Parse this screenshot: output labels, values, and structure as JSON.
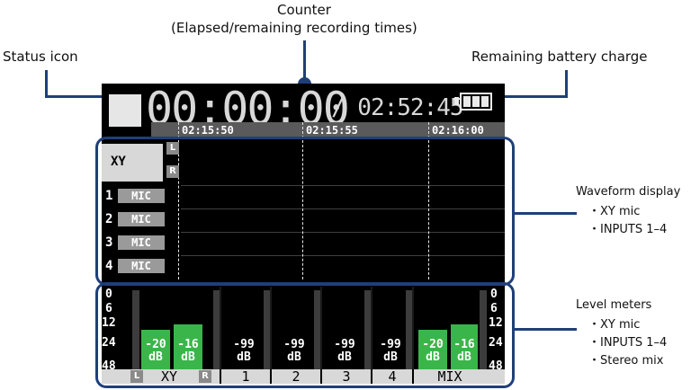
{
  "annotations": {
    "counter_line1": "Counter",
    "counter_line2": "(Elapsed/remaining recording times)",
    "status_icon": "Status icon",
    "battery": "Remaining battery charge",
    "waveform_title": "Waveform display",
    "waveform_items": [
      "・XY mic",
      "・INPUTS 1–4"
    ],
    "level_title": "Level meters",
    "level_items": [
      "・XY mic",
      "・INPUTS 1–4",
      "・Stereo mix"
    ]
  },
  "screen": {
    "elapsed": "00:00:00",
    "slash_remaining": "/ 02:52:45",
    "battery_icon": "battery-full-icon",
    "timeline": [
      "02:15:50",
      "02:15:55",
      "02:16:00"
    ],
    "waveform": {
      "xy_label": "XY",
      "left_tag": "L",
      "right_tag": "R",
      "inputs": [
        {
          "num": "1",
          "tag": "MIC"
        },
        {
          "num": "2",
          "tag": "MIC"
        },
        {
          "num": "3",
          "tag": "MIC"
        },
        {
          "num": "4",
          "tag": "MIC"
        }
      ]
    },
    "meters": {
      "scale": [
        "0",
        "6",
        "12",
        "24",
        "48"
      ],
      "xy_left": {
        "value": "-20",
        "unit": "dB"
      },
      "xy_right": {
        "value": "-16",
        "unit": "dB"
      },
      "in1": {
        "value": "-99",
        "unit": "dB"
      },
      "in2": {
        "value": "-99",
        "unit": "dB"
      },
      "in3": {
        "value": "-99",
        "unit": "dB"
      },
      "in4": {
        "value": "-99",
        "unit": "dB"
      },
      "mix_left": {
        "value": "-20",
        "unit": "dB"
      },
      "mix_right": {
        "value": "-16",
        "unit": "dB"
      },
      "labels": {
        "l": "L",
        "xy": "XY",
        "r": "R",
        "c1": "1",
        "c2": "2",
        "c3": "3",
        "c4": "4",
        "mix": "MIX"
      }
    },
    "colors": {
      "meter_green": "#3ab54a",
      "frame": "#1f3f7a"
    }
  }
}
